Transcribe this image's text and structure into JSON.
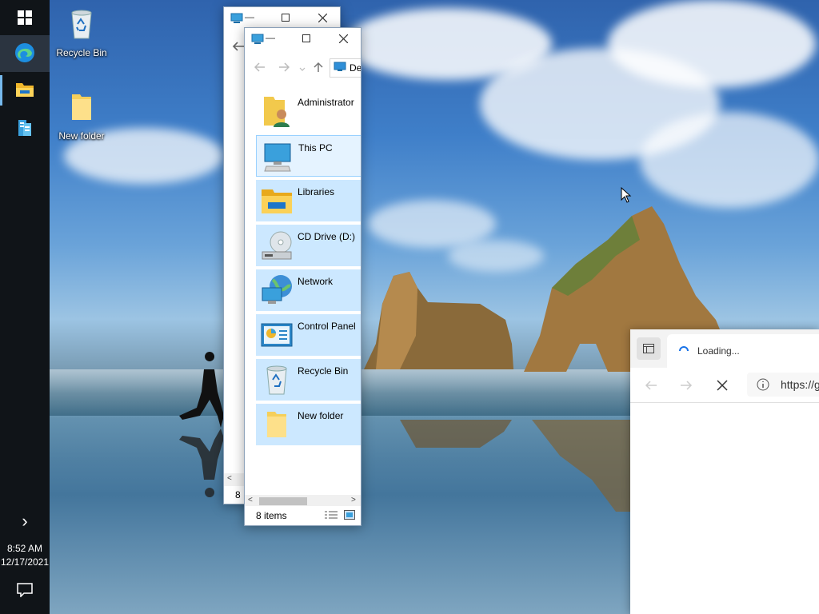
{
  "desktop": {
    "icons": [
      {
        "label": "Recycle Bin",
        "icon": "recycle-bin-icon"
      },
      {
        "label": "New folder",
        "icon": "folder-icon"
      }
    ]
  },
  "taskbar": {
    "apps": [
      {
        "name": "start",
        "icon": "windows-logo-icon"
      },
      {
        "name": "edge",
        "icon": "edge-icon"
      },
      {
        "name": "file-explorer",
        "icon": "file-explorer-icon"
      },
      {
        "name": "server-manager",
        "icon": "server-manager-icon"
      }
    ],
    "clock": {
      "time": "8:52 AM",
      "date": "12/17/2021"
    },
    "expand_glyph": "›"
  },
  "explorer_back": {
    "title_glyph": "—",
    "status_fragment": "8"
  },
  "explorer_front": {
    "address_text": "Desktop",
    "items": [
      {
        "label": "Administrator",
        "icon": "user-folder-icon"
      },
      {
        "label": "This PC",
        "icon": "this-pc-icon"
      },
      {
        "label": "Libraries",
        "icon": "libraries-icon"
      },
      {
        "label": "CD Drive (D:)",
        "icon": "cd-drive-icon"
      },
      {
        "label": "Network",
        "icon": "network-icon"
      },
      {
        "label": "Control Panel",
        "icon": "control-panel-icon"
      },
      {
        "label": "Recycle Bin",
        "icon": "recycle-bin-icon"
      },
      {
        "label": "New folder",
        "icon": "folder-icon"
      }
    ],
    "status": "8 items"
  },
  "browser": {
    "tab_title": "Loading...",
    "url": "https://g"
  },
  "colors": {
    "accent": "#0078d7",
    "selection": "#cce8ff",
    "taskbar": "#101418"
  }
}
